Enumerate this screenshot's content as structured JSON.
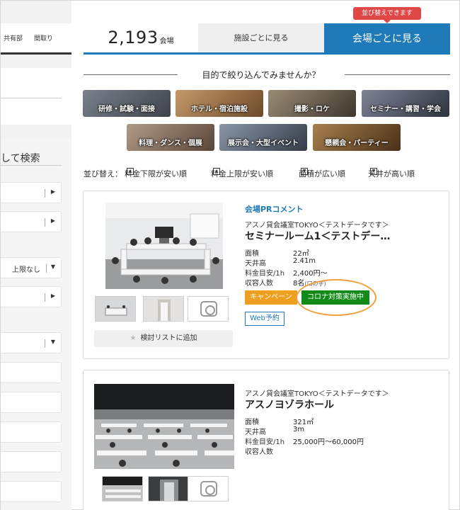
{
  "sidebar": {
    "tabs": [
      "共有部",
      "間取り"
    ],
    "heading": "して検索",
    "max_select": "上限なし"
  },
  "results": {
    "count": "2,193",
    "count_unit": "会場",
    "tab_by_facility": "施設ごとに見る",
    "tab_by_venue": "会場ごとに見る",
    "sort_badge": "並び替えできます"
  },
  "purpose": {
    "title": "目的で絞り込んでみませんか？",
    "categories": [
      {
        "label": "研修・試験・面接",
        "color": "#5a5f6a"
      },
      {
        "label": "ホテル・宿泊施設",
        "color": "#9a6a40"
      },
      {
        "label": "撮影・ロケ",
        "color": "#6e6355"
      },
      {
        "label": "セミナー・講習・学会",
        "color": "#4e5464"
      },
      {
        "label": "料理・ダンス・個展",
        "color": "#8a7462"
      },
      {
        "label": "展示会・大型イベント",
        "color": "#55606e"
      },
      {
        "label": "懇親会・パーティー",
        "color": "#7a5a3a"
      }
    ]
  },
  "sort": {
    "prefix": "並び替え：",
    "options": [
      {
        "label": "料金下限が安い順",
        "icon": "▲"
      },
      {
        "label": "料金上限が安い順",
        "icon": "▲"
      },
      {
        "label": "面積が広い順",
        "icon": "▼"
      },
      {
        "label": "天井が高い順",
        "icon": "▼"
      }
    ]
  },
  "venues": [
    {
      "pr": "会場PRコメント",
      "subtitle": "アスノ貸会議室TOKYO＜テストデータです＞",
      "title": "セミナールーム1＜テストデー…",
      "spec_labels": [
        "面積",
        "天井高",
        "料金目安/1h",
        "収容人数"
      ],
      "area": "22㎡",
      "ceiling": "2.41m",
      "price": "2,400円〜",
      "capacity": "8名",
      "capacity_note": "(口の字)",
      "tag_campaign": "キャンペーン",
      "tag_corona": "コロナ対策実施中",
      "web_reserve": "Web予約",
      "add_list": "検討リストに追加"
    },
    {
      "subtitle": "アスノ貸会議室TOKYO＜テストデータです＞",
      "title": "アスノヨゾラホール",
      "spec_labels": [
        "面積",
        "天井高",
        "料金目安/1h",
        "収容人数"
      ],
      "area": "321㎡",
      "ceiling": "3m",
      "price": "25,000円〜60,000円"
    }
  ]
}
